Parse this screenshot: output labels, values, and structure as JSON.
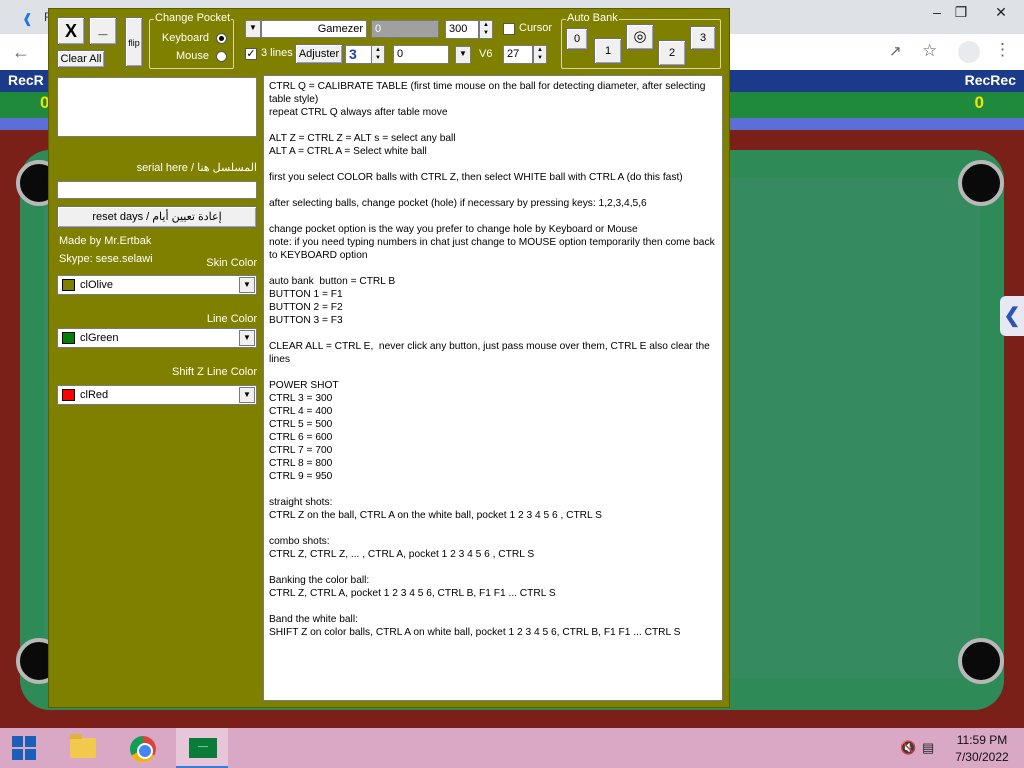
{
  "browser": {
    "tab_fragment": "R",
    "win_minimize": "–",
    "win_restore": "❐",
    "win_close": "✕",
    "icons": {
      "back": "arrow-left-icon",
      "share": "share-icon",
      "star": "star-icon",
      "profile": "profile-icon",
      "menu": "kebab-menu-icon"
    }
  },
  "game": {
    "header_left": "RecR",
    "header_right": "RecRec",
    "score_left": "0",
    "score_right": "0",
    "side_toggle": "❮"
  },
  "toolbar": {
    "close_label": "X",
    "minimize_label": "_",
    "clear_all_label": "Clear All",
    "flip_label": "flip",
    "change_pocket": {
      "title": "Change Pocket",
      "keyboard_label": "Keyboard",
      "mouse_label": "Mouse",
      "selected": "Keyboard"
    },
    "gamezer_label": "Gamezer",
    "value_field": "0",
    "spin_300": "300",
    "cursor_label": "Cursor",
    "cursor_checked": false,
    "three_lines_label": "3 lines",
    "three_lines_checked": true,
    "adjuster_label": "Adjuster",
    "adjuster_value": "3",
    "field_0b": "0",
    "v6_label": "V6",
    "spin_27": "27",
    "auto_bank": {
      "title": "Auto Bank",
      "btn_0": "0",
      "btn_1": "1",
      "btn_target": "target-icon",
      "btn_2": "2",
      "btn_3": "3"
    }
  },
  "left_panel": {
    "serial_label": "serial here / المسلسل هنا",
    "reset_label": "reset days / إعادة تعيين أيام",
    "made_by": "Made by Mr.Ertbak",
    "skype": "Skype: sese.selawi",
    "skin_color": {
      "caption": "Skin Color",
      "value": "clOlive",
      "swatch": "#808000"
    },
    "line_color": {
      "caption": "Line Color",
      "value": "clGreen",
      "swatch": "#008000"
    },
    "shiftz_color": {
      "caption": "Shift Z Line Color",
      "value": "clRed",
      "swatch": "#ff0000"
    }
  },
  "instructions": [
    "CTRL Q = CALIBRATE TABLE (first time mouse on the ball for detecting diameter, after selecting table style)",
    "repeat CTRL Q always after table move",
    "",
    "ALT Z = CTRL Z = ALT s = select any ball",
    "ALT A = CTRL A = Select white ball",
    "",
    "first you select COLOR balls with CTRL Z, then select WHITE ball with CTRL A (do this fast)",
    "",
    "after selecting balls, change pocket (hole) if necessary by pressing keys: 1,2,3,4,5,6",
    "",
    "change pocket option is the way you prefer to change hole by Keyboard or Mouse",
    "note: if you need typing numbers in chat just change to MOUSE option temporarily then come back to KEYBOARD option",
    "",
    "auto bank  button = CTRL B",
    "BUTTON 1 = F1",
    "BUTTON 2 = F2",
    "BUTTON 3 = F3",
    "",
    "CLEAR ALL = CTRL E,  never click any button, just pass mouse over them, CTRL E also clear the lines",
    "",
    "POWER SHOT",
    "CTRL 3 = 300",
    "CTRL 4 = 400",
    "CTRL 5 = 500",
    "CTRL 6 = 600",
    "CTRL 7 = 700",
    "CTRL 8 = 800",
    "CTRL 9 = 950",
    "",
    "straight shots:",
    "CTRL Z on the ball, CTRL A on the white ball, pocket 1 2 3 4 5 6 , CTRL S",
    "",
    "combo shots:",
    "CTRL Z, CTRL Z, ... , CTRL A, pocket 1 2 3 4 5 6 , CTRL S",
    "",
    "Banking the color ball:",
    "CTRL Z, CTRL A, pocket 1 2 3 4 5 6, CTRL B, F1 F1 ... CTRL S",
    "",
    "Band the white ball:",
    "SHIFT Z on color balls, CTRL A on white ball, pocket 1 2 3 4 5 6, CTRL B, F1 F1 ... CTRL S"
  ],
  "taskbar": {
    "start": "windows-start-icon",
    "explorer": "file-explorer-icon",
    "chrome": "chrome-icon",
    "app": "saudi-flag-app-icon",
    "volume": "volume-muted-icon",
    "network": "network-icon",
    "time": "11:59 PM",
    "date": "7/30/2022"
  }
}
